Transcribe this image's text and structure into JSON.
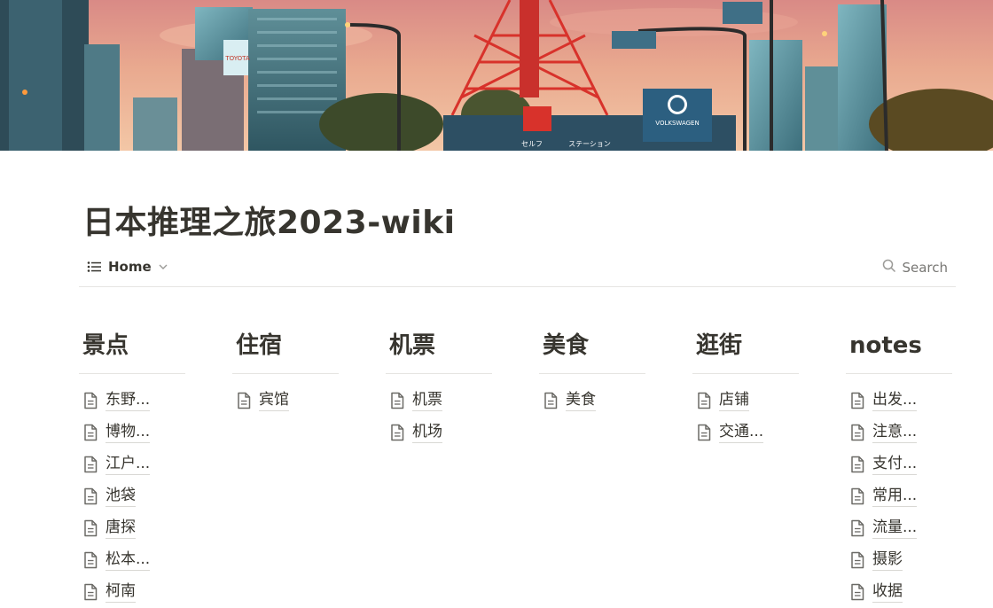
{
  "page": {
    "title": "日本推理之旅2023-wiki"
  },
  "cover": {
    "sign_brand": "VOLKSWAGEN",
    "sign_shop": "セルフ",
    "sign_station": "ステーション",
    "sign_tower": "TOYOTA"
  },
  "toolbar": {
    "view_label": "Home",
    "search_label": "Search"
  },
  "colors": {
    "text": "#37352f",
    "muted": "#787774",
    "divider": "#e6e5e2"
  },
  "columns": [
    {
      "title": "景点",
      "items": [
        "东野...",
        "博物...",
        "江户...",
        "池袋",
        "唐探",
        "松本...",
        "柯南"
      ]
    },
    {
      "title": "住宿",
      "items": [
        "宾馆"
      ]
    },
    {
      "title": "机票",
      "items": [
        "机票",
        "机场"
      ]
    },
    {
      "title": "美食",
      "items": [
        "美食"
      ]
    },
    {
      "title": "逛街",
      "items": [
        "店铺",
        "交通..."
      ]
    },
    {
      "title": "notes",
      "items": [
        "出发...",
        "注意...",
        "支付...",
        "常用...",
        "流量...",
        "摄影",
        "收据"
      ]
    }
  ]
}
